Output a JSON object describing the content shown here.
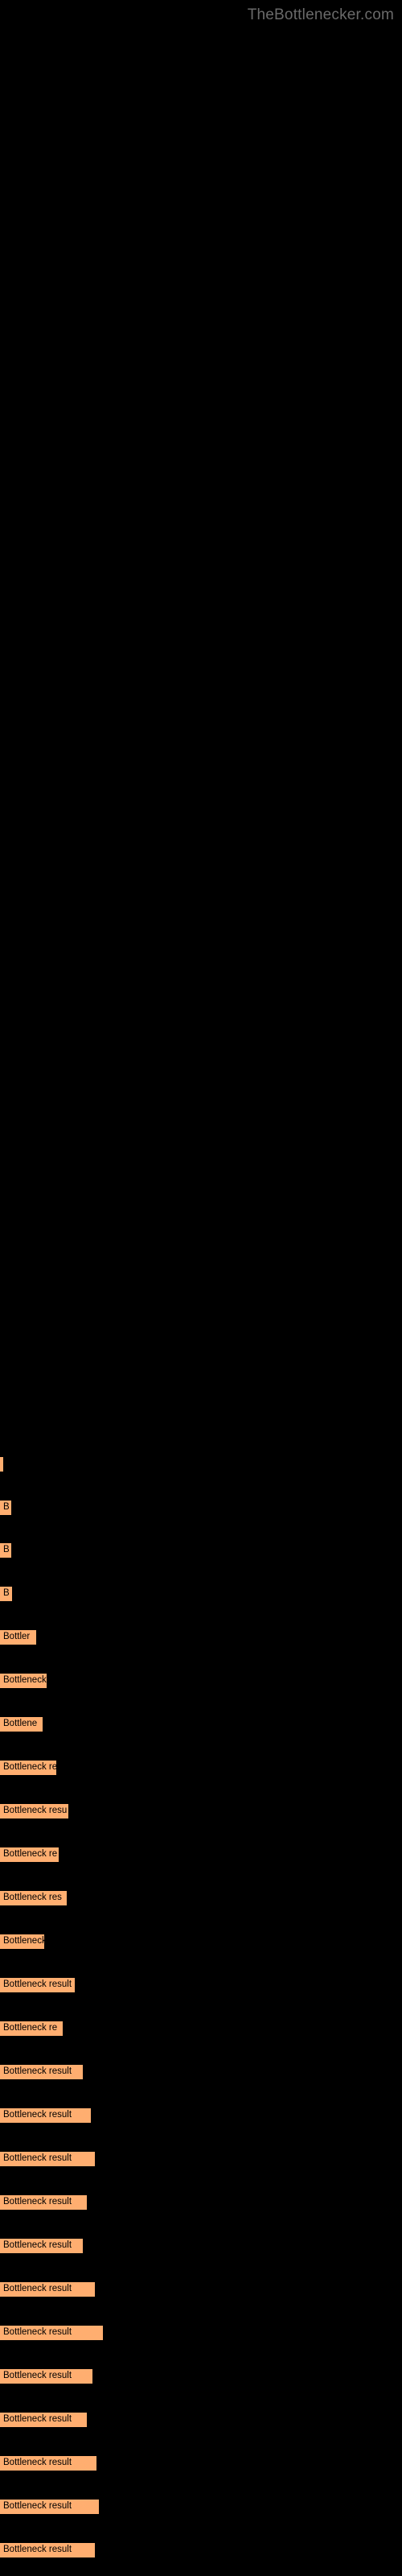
{
  "brand": "TheBottlenecker.com",
  "chart_data": {
    "type": "bar",
    "title": "",
    "subtitle": "",
    "xlabel": "",
    "ylabel": "",
    "orientation": "horizontal",
    "grid": false,
    "legend": false,
    "bar_color": "#ffae70",
    "background": "#000000",
    "xlim": [
      0,
      100
    ],
    "categories": [
      "",
      "",
      "",
      "",
      "",
      "",
      "",
      "",
      "",
      "",
      "",
      "",
      "",
      "",
      "",
      "",
      "",
      "",
      "",
      "",
      "",
      "",
      "",
      "",
      "",
      ""
    ],
    "values": [
      0.6,
      2.8,
      2.8,
      3.0,
      9.0,
      11.5,
      10.5,
      14.0,
      17.0,
      14.5,
      16.5,
      11.0,
      18.5,
      15.5,
      20.5,
      22.5,
      23.5,
      21.5,
      20.5,
      23.5,
      25.5,
      23.0,
      21.5,
      24.0,
      24.5,
      23.5
    ],
    "labels": [
      "",
      "B",
      "B",
      "B",
      "Bottler",
      "Bottleneck",
      "Bottlene",
      "Bottleneck re",
      "Bottleneck resu",
      "Bottleneck re",
      "Bottleneck res",
      "Bottleneck",
      "Bottleneck result",
      "Bottleneck re",
      "Bottleneck result",
      "Bottleneck result",
      "Bottleneck result",
      "Bottleneck result",
      "Bottleneck result",
      "Bottleneck result",
      "Bottleneck result",
      "Bottleneck result",
      "Bottleneck result",
      "Bottleneck result",
      "Bottleneck result",
      "Bottleneck result"
    ],
    "bar_geometry": [
      {
        "top": 2884,
        "height": 28,
        "width": 3,
        "label": ""
      },
      {
        "top": 2970,
        "height": 28,
        "width": 14,
        "label": "B"
      },
      {
        "top": 3056,
        "height": 28,
        "width": 14,
        "label": "B"
      },
      {
        "top": 3142,
        "height": 28,
        "width": 15,
        "label": "B"
      },
      {
        "top": 3228,
        "height": 28,
        "width": 45,
        "label": "Bottler"
      },
      {
        "top": 3314,
        "height": 28,
        "width": 58,
        "label": "Bottleneck"
      },
      {
        "top": 3400,
        "height": 28,
        "width": 53,
        "label": "Bottlene"
      },
      {
        "top": 3486,
        "height": 28,
        "width": 70,
        "label": "Bottleneck re"
      },
      {
        "top": 3572,
        "height": 28,
        "width": 85,
        "label": "Bottleneck resu"
      },
      {
        "top": 3658,
        "height": 28,
        "width": 73,
        "label": "Bottleneck re"
      },
      {
        "top": 3744,
        "height": 28,
        "width": 83,
        "label": "Bottleneck res"
      },
      {
        "top": 3830,
        "height": 28,
        "width": 55,
        "label": "Bottleneck"
      },
      {
        "top": 3916,
        "height": 28,
        "width": 93,
        "label": "Bottleneck result"
      },
      {
        "top": 4002,
        "height": 28,
        "width": 78,
        "label": "Bottleneck re"
      },
      {
        "top": 4088,
        "height": 28,
        "width": 103,
        "label": "Bottleneck result"
      },
      {
        "top": 4174,
        "height": 28,
        "width": 113,
        "label": "Bottleneck result"
      },
      {
        "top": 4260,
        "height": 28,
        "width": 118,
        "label": "Bottleneck result"
      },
      {
        "top": 4346,
        "height": 28,
        "width": 108,
        "label": "Bottleneck result"
      },
      {
        "top": 4432,
        "height": 28,
        "width": 103,
        "label": "Bottleneck result"
      },
      {
        "top": 4518,
        "height": 28,
        "width": 118,
        "label": "Bottleneck result"
      },
      {
        "top": 4604,
        "height": 28,
        "width": 128,
        "label": "Bottleneck result"
      },
      {
        "top": 4690,
        "height": 28,
        "width": 115,
        "label": "Bottleneck result"
      },
      {
        "top": 4776,
        "height": 28,
        "width": 108,
        "label": "Bottleneck result"
      },
      {
        "top": 4862,
        "height": 28,
        "width": 120,
        "label": "Bottleneck result"
      },
      {
        "top": 4948,
        "height": 28,
        "width": 123,
        "label": "Bottleneck result"
      },
      {
        "top": 5034,
        "height": 28,
        "width": 118,
        "label": "Bottleneck result"
      }
    ]
  }
}
